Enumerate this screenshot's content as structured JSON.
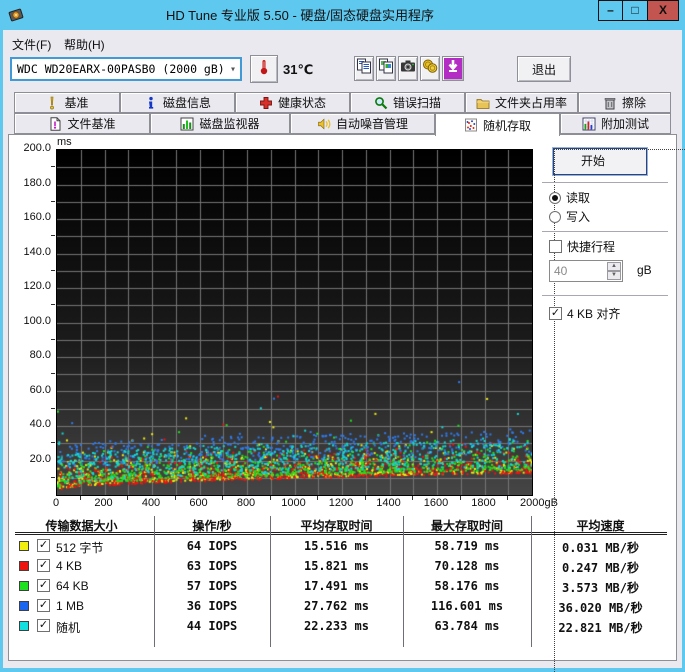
{
  "window": {
    "title": "HD Tune 专业版 5.50 - 硬盘/固态硬盘实用程序",
    "minimize_glyph": "–",
    "maximize_glyph": "□",
    "close_glyph": "X"
  },
  "menu": {
    "file": "文件(F)",
    "help": "帮助(H)"
  },
  "toolbar": {
    "drive": "WDC WD20EARX-00PASB0 (2000 gB)",
    "temperature": "31℃",
    "exit_label": "退出"
  },
  "icons": {
    "combo_arrow": "▾",
    "spinner_up": "▲",
    "spinner_down": "▼",
    "check": "✓"
  },
  "tabs": {
    "row1": [
      {
        "id": "benchmark",
        "label": "基准",
        "icon": "exclamation"
      },
      {
        "id": "disk-info",
        "label": "磁盘信息",
        "icon": "info"
      },
      {
        "id": "health",
        "label": "健康状态",
        "icon": "health-cross"
      },
      {
        "id": "error-scan",
        "label": "错误扫描",
        "icon": "magnifier"
      },
      {
        "id": "folder-usage",
        "label": "文件夹占用率",
        "icon": "folder"
      },
      {
        "id": "erase",
        "label": "擦除",
        "icon": "trash"
      }
    ],
    "row2": [
      {
        "id": "file-benchmark",
        "label": "文件基准",
        "icon": "file"
      },
      {
        "id": "disk-monitor",
        "label": "磁盘监视器",
        "icon": "monitor-bars"
      },
      {
        "id": "aam",
        "label": "自动噪音管理",
        "icon": "speaker"
      },
      {
        "id": "random-access",
        "label": "随机存取",
        "icon": "scatter",
        "active": true
      },
      {
        "id": "extra-tests",
        "label": "附加测试",
        "icon": "extra-chart"
      }
    ]
  },
  "controls": {
    "start_label": "开始",
    "mode_read": "读取",
    "mode_write": "写入",
    "read_checked": true,
    "write_checked": false,
    "shortstroke_label": "快捷行程",
    "shortstroke_checked": false,
    "capacity_value": "40",
    "capacity_unit": "gB",
    "align_label": "4 KB 对齐",
    "align_checked": true
  },
  "results_table": {
    "headers": [
      "传输数据大小",
      "操作/秒",
      "平均存取时间",
      "最大存取时间",
      "平均速度"
    ],
    "rows": [
      {
        "color": "#f2ee10",
        "checked": true,
        "label": "512 字节",
        "iops": "64 IOPS",
        "avg_access": "15.516 ms",
        "max_access": "58.719 ms",
        "avg_speed": "0.031 MB/秒"
      },
      {
        "color": "#ee1410",
        "checked": true,
        "label": "4 KB",
        "iops": "63 IOPS",
        "avg_access": "15.821 ms",
        "max_access": "70.128 ms",
        "avg_speed": "0.247 MB/秒"
      },
      {
        "color": "#1ee01e",
        "checked": true,
        "label": "64 KB",
        "iops": "57 IOPS",
        "avg_access": "17.491 ms",
        "max_access": "58.176 ms",
        "avg_speed": "3.573 MB/秒"
      },
      {
        "color": "#1a66f0",
        "checked": true,
        "label": "1 MB",
        "iops": "36 IOPS",
        "avg_access": "27.762 ms",
        "max_access": "116.601 ms",
        "avg_speed": "36.020 MB/秒"
      },
      {
        "color": "#12e0e0",
        "checked": true,
        "label": "随机",
        "iops": "44 IOPS",
        "avg_access": "22.233 ms",
        "max_access": "63.784 ms",
        "avg_speed": "22.821 MB/秒"
      }
    ]
  },
  "chart_data": {
    "type": "scatter",
    "title": "随机存取 访问时间散点图",
    "xlabel": "gB",
    "ylabel": "ms",
    "xlim": [
      0,
      2000
    ],
    "ylim": [
      0,
      200
    ],
    "x_tick_labels": [
      "0",
      "200",
      "400",
      "600",
      "800",
      "1000",
      "1200",
      "1400",
      "1600",
      "1800",
      "2000gB"
    ],
    "y_tick_labels": [
      "200.0",
      "180.0",
      "160.0",
      "140.0",
      "120.0",
      "100.0",
      "80.0",
      "60.0",
      "40.0",
      "20.0"
    ],
    "x_grid_step": 100,
    "y_grid_step": 10,
    "grid": true,
    "legend_position": "table-below",
    "plot_bg_top": "#000000",
    "plot_bg_mid": "#1b1b1b",
    "plot_bg_bottom": "#464646",
    "grid_color": "#757575",
    "seed": 20130,
    "x_density_split": 1480,
    "x_density_frac": 0.8,
    "series": [
      {
        "name": "512 字节",
        "color": "#f2ee10",
        "count": 680,
        "floor0": 3.0,
        "floor1": 13.0,
        "spread": 11,
        "dist": "hug",
        "outlier_max": 58.7
      },
      {
        "name": "4 KB",
        "color": "#ee1410",
        "count": 680,
        "floor0": 2.2,
        "floor1": 12.5,
        "spread": 11,
        "dist": "hug",
        "outlier_max": 70.1
      },
      {
        "name": "64 KB",
        "color": "#1ee01e",
        "count": 660,
        "floor0": 4.2,
        "floor1": 14.5,
        "spread": 11,
        "dist": "hug",
        "outlier_max": 58.2
      },
      {
        "name": "1 MB",
        "color": "#2e7bee",
        "count": 430,
        "floor0": 14.0,
        "floor1": 23.0,
        "spread": 12,
        "dist": "band",
        "outlier_max": 116.6
      },
      {
        "name": "随机",
        "color": "#12d8d8",
        "count": 620,
        "floor0": 5.0,
        "floor1": 16.0,
        "spread": 14,
        "dist": "band",
        "outlier_max": 63.8
      }
    ],
    "note_avg_access_ms": [
      15.516,
      15.821,
      17.491,
      27.762,
      22.233
    ],
    "note_max_access_ms": [
      58.719,
      70.128,
      58.176,
      116.601,
      63.784
    ]
  }
}
